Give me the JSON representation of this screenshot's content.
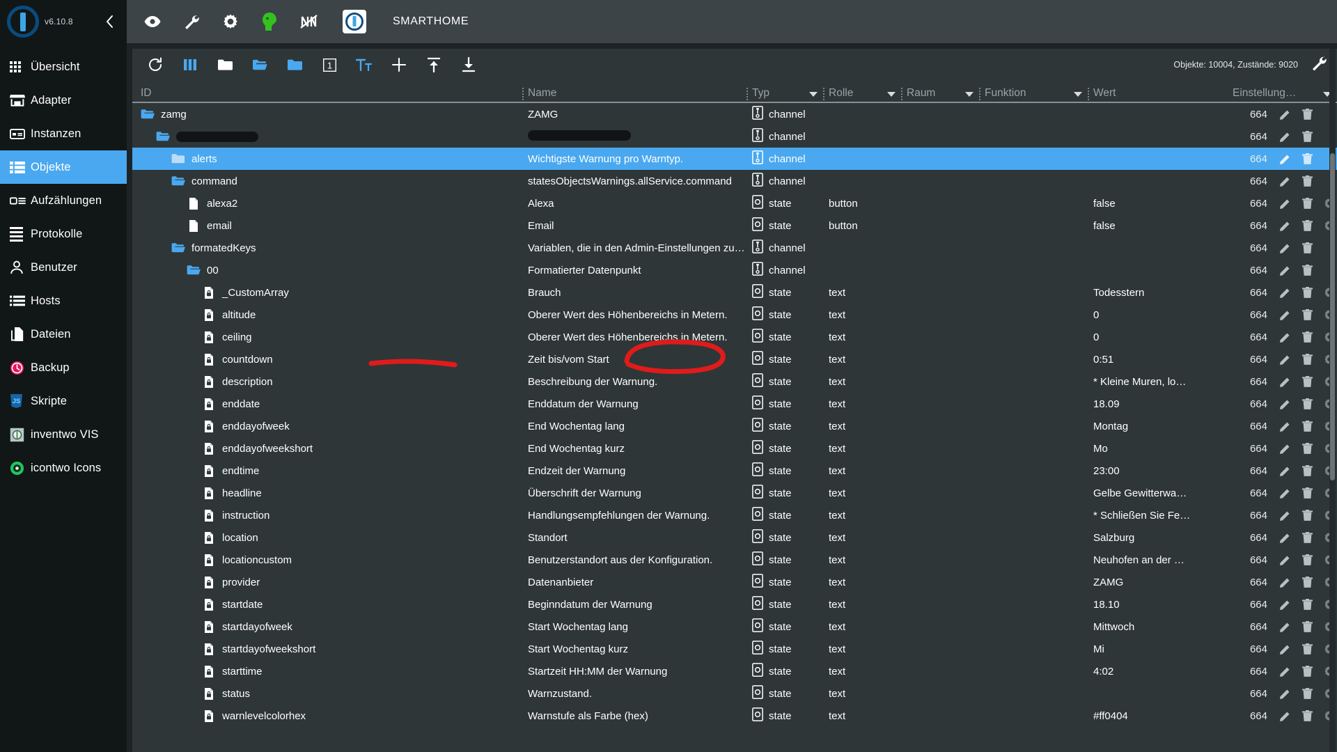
{
  "sidebar": {
    "version": "v6.10.8",
    "collapse_icon": "chevron-left-icon",
    "items": [
      {
        "label": "Übersicht",
        "icon": "grid-icon",
        "active": false
      },
      {
        "label": "Adapter",
        "icon": "store-icon",
        "active": false
      },
      {
        "label": "Instanzen",
        "icon": "instances-icon",
        "active": false
      },
      {
        "label": "Objekte",
        "icon": "list-icon",
        "active": true
      },
      {
        "label": "Aufzählungen",
        "icon": "enum-icon",
        "active": false
      },
      {
        "label": "Protokolle",
        "icon": "log-icon",
        "active": false
      },
      {
        "label": "Benutzer",
        "icon": "user-icon",
        "active": false
      },
      {
        "label": "Hosts",
        "icon": "hosts-icon",
        "active": false
      },
      {
        "label": "Dateien",
        "icon": "files-icon",
        "active": false
      },
      {
        "label": "Backup",
        "icon": "backup-icon",
        "active": false
      },
      {
        "label": "Skripte",
        "icon": "js-icon",
        "active": false
      },
      {
        "label": "inventwo VIS",
        "icon": "vis-icon",
        "active": false
      },
      {
        "label": "icontwo Icons",
        "icon": "icontwo-icon",
        "active": false
      }
    ]
  },
  "topbar": {
    "title": "SMARTHOME",
    "icons": [
      "eye-icon",
      "wrench-icon",
      "gear-icon",
      "green-head-icon",
      "no-sync-icon"
    ],
    "app_icon": "iobroker-logo-icon"
  },
  "toolbar": {
    "icons": [
      "refresh-icon",
      "columns-icon",
      "collapse-all-icon",
      "expand-folder-icon",
      "filter-folder-icon",
      "depth-one-icon",
      "text-size-icon",
      "add-icon",
      "import-icon",
      "export-icon"
    ],
    "status": "Objekte: 10004, Zustände: 9020",
    "settings_icon": "wrench-icon"
  },
  "table": {
    "columns": [
      {
        "key": "id",
        "label": "ID",
        "sortable": false
      },
      {
        "key": "name",
        "label": "Name",
        "sortable": false
      },
      {
        "key": "typ",
        "label": "Typ",
        "sortable": true
      },
      {
        "key": "rolle",
        "label": "Rolle",
        "sortable": true
      },
      {
        "key": "raum",
        "label": "Raum",
        "sortable": true
      },
      {
        "key": "funk",
        "label": "Funktion",
        "sortable": true
      },
      {
        "key": "wert",
        "label": "Wert",
        "sortable": false
      },
      {
        "key": "einst",
        "label": "Einstellung…",
        "sortable": true
      }
    ],
    "rows": [
      {
        "id": "zamg",
        "indent": 0,
        "icon": "folder-open-icon",
        "name": "ZAMG",
        "typ": "channel",
        "rolle": "",
        "wert": "",
        "perm": "664",
        "selected": false,
        "gear": false,
        "redacted": false
      },
      {
        "id": "",
        "indent": 1,
        "icon": "folder-open-icon",
        "name": "",
        "typ": "channel",
        "rolle": "",
        "wert": "",
        "perm": "664",
        "selected": false,
        "gear": false,
        "redacted": true
      },
      {
        "id": "alerts",
        "indent": 2,
        "icon": "folder-icon",
        "name": "Wichtigste Warnung pro Warntyp.",
        "typ": "channel",
        "rolle": "",
        "wert": "",
        "perm": "664",
        "selected": true,
        "gear": false,
        "redacted": false
      },
      {
        "id": "command",
        "indent": 2,
        "icon": "folder-open-icon",
        "name": "statesObjectsWarnings.allService.command",
        "typ": "channel",
        "rolle": "",
        "wert": "",
        "perm": "664",
        "selected": false,
        "gear": false,
        "redacted": false
      },
      {
        "id": "alexa2",
        "indent": 3,
        "icon": "doc-icon",
        "name": "Alexa",
        "typ": "state",
        "rolle": "button",
        "wert": "false",
        "perm": "664",
        "selected": false,
        "gear": true,
        "redacted": false
      },
      {
        "id": "email",
        "indent": 3,
        "icon": "doc-icon",
        "name": "Email",
        "typ": "state",
        "rolle": "button",
        "wert": "false",
        "perm": "664",
        "selected": false,
        "gear": true,
        "redacted": false
      },
      {
        "id": "formatedKeys",
        "indent": 2,
        "icon": "folder-open-icon",
        "name": "Variablen, die in den Admin-Einstellungen zum Kon…",
        "typ": "channel",
        "rolle": "",
        "wert": "",
        "perm": "664",
        "selected": false,
        "gear": false,
        "redacted": false
      },
      {
        "id": "00",
        "indent": 3,
        "icon": "folder-open-icon",
        "name": "Formatierter Datenpunkt",
        "typ": "channel",
        "rolle": "",
        "wert": "",
        "perm": "664",
        "selected": false,
        "gear": false,
        "redacted": false
      },
      {
        "id": "_CustomArray",
        "indent": 4,
        "icon": "doc-lock-icon",
        "name": "Brauch",
        "typ": "state",
        "rolle": "text",
        "wert": "Todesstern",
        "perm": "664",
        "selected": false,
        "gear": true,
        "redacted": false
      },
      {
        "id": "altitude",
        "indent": 4,
        "icon": "doc-lock-icon",
        "name": "Oberer Wert des Höhenbereichs in Metern.",
        "typ": "state",
        "rolle": "text",
        "wert": "0",
        "perm": "664",
        "selected": false,
        "gear": true,
        "redacted": false
      },
      {
        "id": "ceiling",
        "indent": 4,
        "icon": "doc-lock-icon",
        "name": "Oberer Wert des Höhenbereichs in Metern.",
        "typ": "state",
        "rolle": "text",
        "wert": "0",
        "perm": "664",
        "selected": false,
        "gear": true,
        "redacted": false
      },
      {
        "id": "countdown",
        "indent": 4,
        "icon": "doc-lock-icon",
        "name": "Zeit bis/vom Start",
        "typ": "state",
        "rolle": "text",
        "wert": "0:51",
        "perm": "664",
        "selected": false,
        "gear": true,
        "redacted": false
      },
      {
        "id": "description",
        "indent": 4,
        "icon": "doc-lock-icon",
        "name": "Beschreibung der Warnung.",
        "typ": "state",
        "rolle": "text",
        "wert": "* Kleine Muren, lo…",
        "perm": "664",
        "selected": false,
        "gear": true,
        "redacted": false
      },
      {
        "id": "enddate",
        "indent": 4,
        "icon": "doc-lock-icon",
        "name": "Enddatum der Warnung",
        "typ": "state",
        "rolle": "text",
        "wert": "18.09",
        "perm": "664",
        "selected": false,
        "gear": true,
        "redacted": false
      },
      {
        "id": "enddayofweek",
        "indent": 4,
        "icon": "doc-lock-icon",
        "name": "End Wochentag lang",
        "typ": "state",
        "rolle": "text",
        "wert": "Montag",
        "perm": "664",
        "selected": false,
        "gear": true,
        "redacted": false
      },
      {
        "id": "enddayofweekshort",
        "indent": 4,
        "icon": "doc-lock-icon",
        "name": "End Wochentag kurz",
        "typ": "state",
        "rolle": "text",
        "wert": "Mo",
        "perm": "664",
        "selected": false,
        "gear": true,
        "redacted": false
      },
      {
        "id": "endtime",
        "indent": 4,
        "icon": "doc-lock-icon",
        "name": "Endzeit der Warnung",
        "typ": "state",
        "rolle": "text",
        "wert": "23:00",
        "perm": "664",
        "selected": false,
        "gear": true,
        "redacted": false
      },
      {
        "id": "headline",
        "indent": 4,
        "icon": "doc-lock-icon",
        "name": "Überschrift der Warnung",
        "typ": "state",
        "rolle": "text",
        "wert": "Gelbe Gewitterwa…",
        "perm": "664",
        "selected": false,
        "gear": true,
        "redacted": false
      },
      {
        "id": "instruction",
        "indent": 4,
        "icon": "doc-lock-icon",
        "name": "Handlungsempfehlungen der Warnung.",
        "typ": "state",
        "rolle": "text",
        "wert": "* Schließen Sie Fe…",
        "perm": "664",
        "selected": false,
        "gear": true,
        "redacted": false
      },
      {
        "id": "location",
        "indent": 4,
        "icon": "doc-lock-icon",
        "name": "Standort",
        "typ": "state",
        "rolle": "text",
        "wert": "Salzburg",
        "perm": "664",
        "selected": false,
        "gear": true,
        "redacted": false
      },
      {
        "id": "locationcustom",
        "indent": 4,
        "icon": "doc-lock-icon",
        "name": "Benutzerstandort aus der Konfiguration.",
        "typ": "state",
        "rolle": "text",
        "wert": "Neuhofen an der …",
        "perm": "664",
        "selected": false,
        "gear": true,
        "redacted": false
      },
      {
        "id": "provider",
        "indent": 4,
        "icon": "doc-lock-icon",
        "name": "Datenanbieter",
        "typ": "state",
        "rolle": "text",
        "wert": "ZAMG",
        "perm": "664",
        "selected": false,
        "gear": true,
        "redacted": false
      },
      {
        "id": "startdate",
        "indent": 4,
        "icon": "doc-lock-icon",
        "name": "Beginndatum der Warnung",
        "typ": "state",
        "rolle": "text",
        "wert": "18.10",
        "perm": "664",
        "selected": false,
        "gear": true,
        "redacted": false
      },
      {
        "id": "startdayofweek",
        "indent": 4,
        "icon": "doc-lock-icon",
        "name": "Start Wochentag lang",
        "typ": "state",
        "rolle": "text",
        "wert": "Mittwoch",
        "perm": "664",
        "selected": false,
        "gear": true,
        "redacted": false
      },
      {
        "id": "startdayofweekshort",
        "indent": 4,
        "icon": "doc-lock-icon",
        "name": "Start Wochentag kurz",
        "typ": "state",
        "rolle": "text",
        "wert": "Mi",
        "perm": "664",
        "selected": false,
        "gear": true,
        "redacted": false
      },
      {
        "id": "starttime",
        "indent": 4,
        "icon": "doc-lock-icon",
        "name": "Startzeit HH:MM der Warnung",
        "typ": "state",
        "rolle": "text",
        "wert": "4:02",
        "perm": "664",
        "selected": false,
        "gear": true,
        "redacted": false
      },
      {
        "id": "status",
        "indent": 4,
        "icon": "doc-lock-icon",
        "name": "Warnzustand.",
        "typ": "state",
        "rolle": "text",
        "wert": "",
        "perm": "664",
        "selected": false,
        "gear": true,
        "redacted": false
      },
      {
        "id": "warnlevelcolorhex",
        "indent": 4,
        "icon": "doc-lock-icon",
        "name": "Warnstufe als Farbe (hex)",
        "typ": "state",
        "rolle": "text",
        "wert": "#ff0404",
        "perm": "664",
        "selected": false,
        "gear": true,
        "redacted": false
      }
    ]
  },
  "annotations": {
    "underline": {
      "target": "_CustomArray",
      "color": "#e01b1b"
    },
    "circle": {
      "target": "Brauch",
      "color": "#e01b1b"
    }
  },
  "colors": {
    "accent": "#4aa8f0",
    "panel": "#2e3638",
    "sidebar": "#111617",
    "topbar": "#3c4447",
    "annotation": "#e01b1b"
  }
}
